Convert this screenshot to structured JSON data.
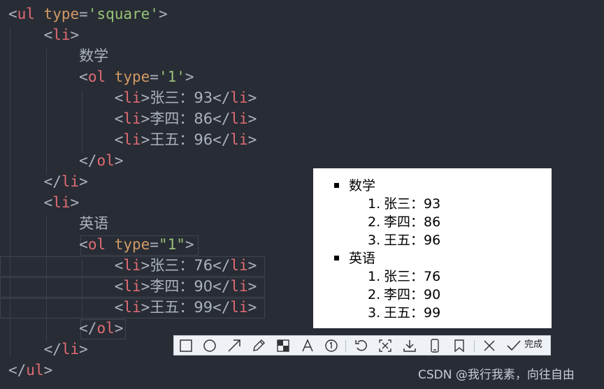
{
  "editor": {
    "colors": {
      "background": "#282c34",
      "tag": "#e06c75",
      "attr": "#d19a66",
      "string": "#98c379",
      "text": "#abb2bf"
    },
    "lines": [
      {
        "indent": "",
        "lt": "<",
        "tag": "ul",
        "attr": "type",
        "eq": "=",
        "val": "'square'",
        "gt": ">"
      },
      {
        "indent": "    ",
        "lt": "<",
        "tag": "li",
        "gt": ">"
      },
      {
        "indent": "        ",
        "text": "数学"
      },
      {
        "indent": "        ",
        "lt": "<",
        "tag": "ol",
        "attr": "type",
        "eq": "=",
        "val": "'1'",
        "gt": ">"
      },
      {
        "indent": "            ",
        "lt": "<",
        "tag": "li",
        "gt": ">",
        "text": "张三：93",
        "close_lt": "</",
        "close_tag": "li",
        "close_gt": ">"
      },
      {
        "indent": "            ",
        "lt": "<",
        "tag": "li",
        "gt": ">",
        "text": "李四：86",
        "close_lt": "</",
        "close_tag": "li",
        "close_gt": ">"
      },
      {
        "indent": "            ",
        "lt": "<",
        "tag": "li",
        "gt": ">",
        "text": "王五：96",
        "close_lt": "</",
        "close_tag": "li",
        "close_gt": ">"
      },
      {
        "indent": "        ",
        "lt": "</",
        "tag": "ol",
        "gt": ">"
      },
      {
        "indent": "    ",
        "lt": "</",
        "tag": "li",
        "gt": ">"
      },
      {
        "indent": "    ",
        "lt": "<",
        "tag": "li",
        "gt": ">"
      },
      {
        "indent": "        ",
        "text": "英语"
      },
      {
        "indent": "        ",
        "lt": "<",
        "tag": "ol",
        "attr": "type",
        "eq": "=",
        "val": "\"1\"",
        "gt": ">"
      },
      {
        "indent": "            ",
        "lt": "<",
        "tag": "li",
        "gt": ">",
        "text": "张三：76",
        "close_lt": "</",
        "close_tag": "li",
        "close_gt": ">"
      },
      {
        "indent": "            ",
        "lt": "<",
        "tag": "li",
        "gt": ">",
        "text": "李四：90",
        "close_lt": "</",
        "close_tag": "li",
        "close_gt": ">"
      },
      {
        "indent": "            ",
        "lt": "<",
        "tag": "li",
        "gt": ">",
        "text": "王五：99",
        "close_lt": "</",
        "close_tag": "li",
        "close_gt": ">"
      },
      {
        "indent": "        ",
        "lt": "</",
        "tag": "ol",
        "gt": ">"
      },
      {
        "indent": "    ",
        "lt": "</",
        "tag": "li",
        "gt": ">"
      },
      {
        "indent": "",
        "lt": "</",
        "tag": "ul",
        "gt": ">"
      }
    ]
  },
  "preview": {
    "groups": [
      {
        "title": "数学",
        "items": [
          {
            "num": "1.",
            "text": "张三：93"
          },
          {
            "num": "2.",
            "text": "李四：86"
          },
          {
            "num": "3.",
            "text": "王五：96"
          }
        ]
      },
      {
        "title": "英语",
        "items": [
          {
            "num": "1.",
            "text": "张三：76"
          },
          {
            "num": "2.",
            "text": "李四：90"
          },
          {
            "num": "3.",
            "text": "王五：99"
          }
        ]
      }
    ]
  },
  "toolbar": {
    "tools": [
      "rectangle-icon",
      "ellipse-icon",
      "arrow-icon",
      "pencil-icon",
      "mosaic-icon",
      "text-icon",
      "number-icon",
      "undo-icon",
      "ocr-icon",
      "download-icon",
      "phone-icon",
      "pin-icon",
      "cancel-icon"
    ],
    "done_label": "完成"
  },
  "watermark": "CSDN @我行我素，向往自由"
}
